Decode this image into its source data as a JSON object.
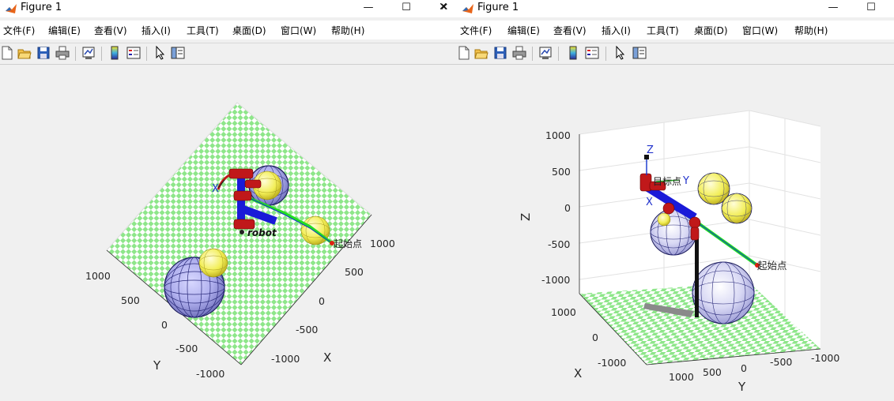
{
  "window_title": "Figure 1",
  "menu": [
    "文件(F)",
    "编辑(E)",
    "查看(V)",
    "插入(I)",
    "工具(T)",
    "桌面(D)",
    "窗口(W)",
    "帮助(H)"
  ],
  "titlebar": {
    "minimize": "—",
    "maximize": "☐",
    "close": "✕"
  },
  "toolbar_icons": [
    "new-figure-icon",
    "open-file-icon",
    "save-icon",
    "print-icon",
    "link-plot-icon",
    "colorbar-icon",
    "legend-icon",
    "pointer-icon",
    "property-editor-icon"
  ],
  "left_plot": {
    "x_axis_label": "X",
    "y_axis_label": "Y",
    "x_ticks": [
      "1000",
      "500",
      "0",
      "-500",
      "-1000"
    ],
    "y_ticks": [
      "1000",
      "500",
      "0",
      "-500",
      "-1000"
    ],
    "robot_label": "robot",
    "start_label": "起始点",
    "frame_label": "X"
  },
  "right_plot": {
    "x_axis_label": "X",
    "y_axis_label": "Y",
    "z_axis_label": "Z",
    "z_ticks": [
      "1000",
      "500",
      "0",
      "-500",
      "-1000"
    ],
    "x_ticks": [
      "1000",
      "0",
      "-1000"
    ],
    "y_ticks": [
      "1000",
      "500",
      "0",
      "-500",
      "-1000"
    ],
    "start_label": "起始点",
    "target_label": "目标点",
    "frame_z": "Z",
    "frame_y": "Y",
    "frame_x": "X"
  },
  "colors": {
    "floor_green": "#8ee68a",
    "sphere_blue": "#2a2a7a",
    "sphere_yellow": "#f2ee55",
    "robot_red": "#c0181a",
    "robot_blue": "#1a1ad8",
    "path_green": "#22dd22"
  }
}
